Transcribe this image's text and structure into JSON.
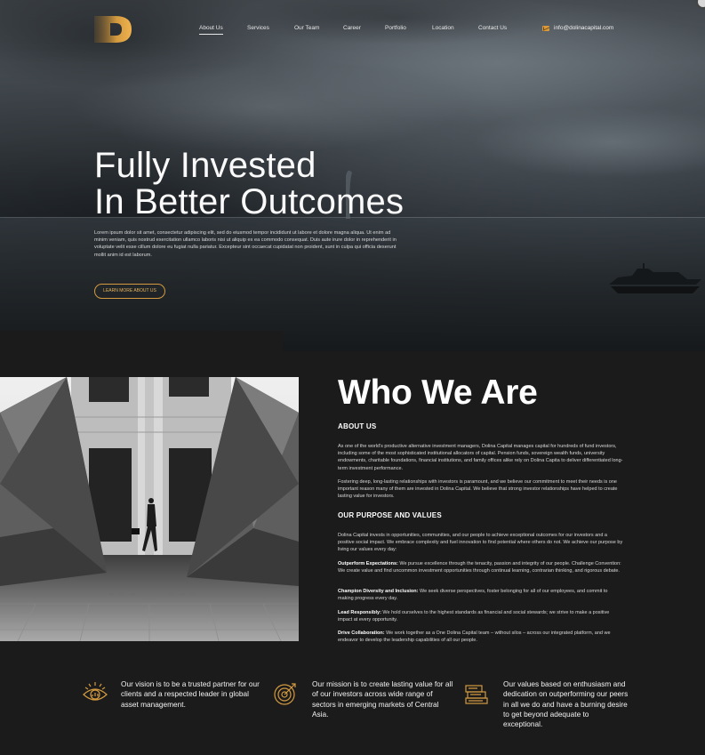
{
  "brand": {
    "logo_letter": "D",
    "accent": "#d39a3f"
  },
  "nav": {
    "items": [
      {
        "label": "About Us",
        "active": true
      },
      {
        "label": "Services",
        "active": false
      },
      {
        "label": "Our Team",
        "active": false
      },
      {
        "label": "Career",
        "active": false
      },
      {
        "label": "Portfolio",
        "active": false
      },
      {
        "label": "Location",
        "active": false
      },
      {
        "label": "Contact Us",
        "active": false
      }
    ],
    "email": "info@dolinacapital.com",
    "email_icon": "envelope-icon"
  },
  "hero": {
    "title_line1": "Fully Invested",
    "title_line2": "In Better Outcomes",
    "body": "Lorem ipsum dolor sit amet, consectetur adipiscing elit, sed do eiusmod tempor incididunt ut labore et dolore magna aliqua. Ut enim ad minim veniam, quis nostrud exercitation ullamco laboris nisi ut aliquip ex ea commodo consequat. Duis aute irure dolor in reprehenderit in voluptate velit esse cillum dolore eu fugiat nulla pariatur. Excepteur sint occaecat cupidatat non proident, sunt in culpa qui officia deserunt mollit anim id est laborum.",
    "button": "LEARN MORE ABOUT US"
  },
  "about": {
    "title": "Who We Are",
    "heading1": "ABOUT US",
    "p1": "As one of the world's productive alternative investment managers, Dolina Capital manages capital for hundreds of fund investors, including some of the most sophisticated institutional allocators of capital. Pension funds, sovereign wealth funds, university endowments, charitable foundations, financial institutions, and family offices alike rely on Dolina Capita to deliver differentiated long-term investment performance.",
    "p2": "Fostering deep, long-lasting relationships with investors is paramount, and we believe our commitment to meet their needs is one important reason many of them are invested in  Dolina Capital. We believe that strong investor relationships have helped to create lasting value for investors.",
    "heading2": "OUR PURPOSE AND VALUES",
    "p3": "Dolina Capital invests in opportunities, communities, and our people to achieve exceptional outcomes for our investors and a positive social impact. We embrace complexity and fuel innovation to find potential where others do not. We achieve our purpose by living our values every day:",
    "values": [
      {
        "label": "Outperform Expectations:",
        "text": " We pursue excellence through the tenacity, passion and integrity of our people. Challenge Convention: We create value and find uncommon investment opportunities through continual learning, contrarian thinking, and rigorous debate."
      },
      {
        "label": "Champion Diversity and Inclusion:",
        "text": " We seek diverse perspectives, foster belonging for all of our employees, and commit to making progress every day."
      },
      {
        "label": "Lead Responsibly:",
        "text": " We hold ourselves to the highest standards as financial and social stewards; we strive to make a positive impact at every opportunity."
      },
      {
        "label": "Drive Collaboration:",
        "text": " We work together as a One Dolina Capital team – without silos – across our integrated platform, and we endeavor to develop the leadership capabilities of all our people."
      }
    ]
  },
  "statements": [
    {
      "icon": "vision-eye-icon",
      "text": "Our vision is to be a trusted partner for our clients and  a respected leader in global asset management."
    },
    {
      "icon": "target-icon",
      "text": "Our mission is to create lasting value for all of our  investors across wide range of sectors in emerging  markets of Central Asia."
    },
    {
      "icon": "books-icon",
      "text": "Our values based on enthusiasm and dedication on  outperforming our peers in all we do and have a burning desire to get beyond adequate to exceptional."
    }
  ]
}
